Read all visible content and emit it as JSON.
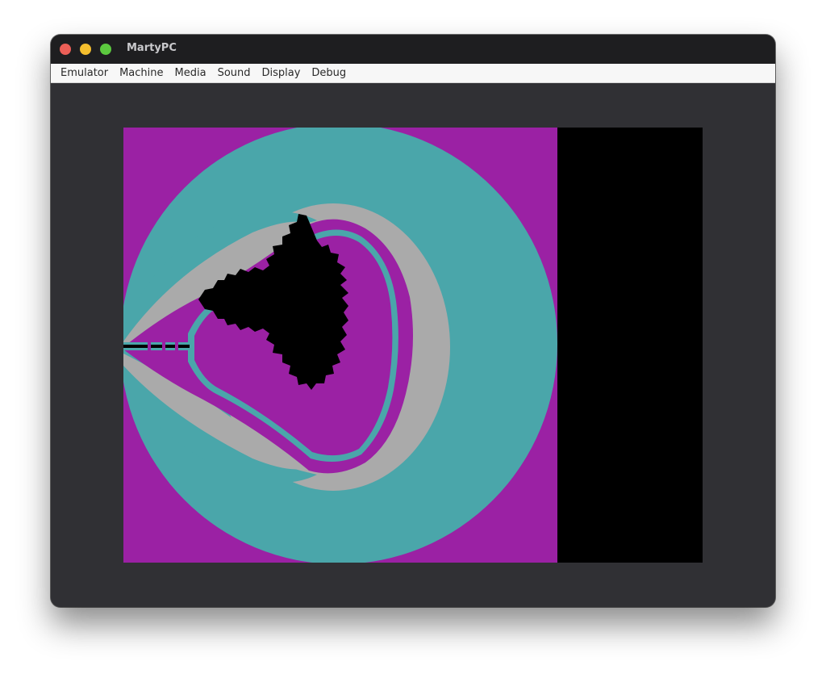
{
  "window": {
    "title": "MartyPC"
  },
  "traffic_lights": [
    {
      "name": "close",
      "color": "#ec5f57"
    },
    {
      "name": "minimize",
      "color": "#f5bf2e"
    },
    {
      "name": "maximize",
      "color": "#5cc93f"
    }
  ],
  "menu": [
    {
      "label": "Emulator"
    },
    {
      "label": "Machine"
    },
    {
      "label": "Media"
    },
    {
      "label": "Sound"
    },
    {
      "label": "Display"
    },
    {
      "label": "Debug"
    }
  ],
  "display": {
    "content": "Mandelbrot set fractal rendered in CGA palette",
    "palette": {
      "background": "#000000",
      "magenta": "#9b21a4",
      "cyan": "#4aa6aa",
      "gray": "#aaaaaa",
      "set": "#000000"
    }
  }
}
